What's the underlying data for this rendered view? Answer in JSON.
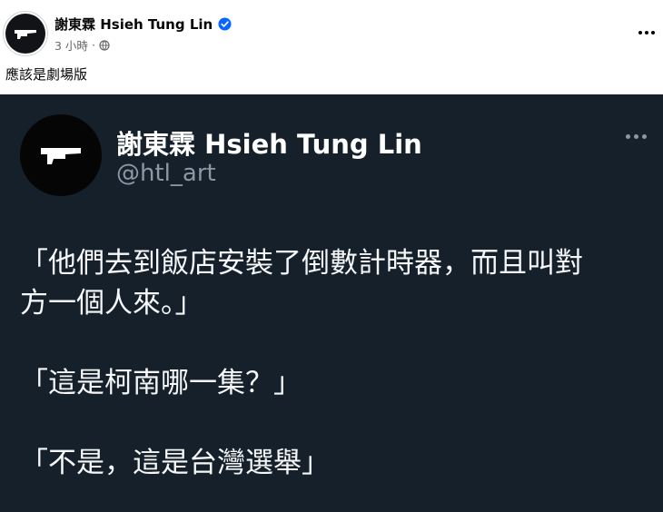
{
  "post": {
    "author_name": "謝東霖 Hsieh Tung Lin",
    "timestamp": "3 小時",
    "separator": "·",
    "caption": "應該是劇場版",
    "icons": {
      "verified": "verified-badge-icon",
      "audience": "globe-icon",
      "more": "more-options-icon"
    }
  },
  "tweet": {
    "display_name": "謝東霖 Hsieh Tung Lin",
    "handle": "@htl_art",
    "lines": [
      "「他們去到飯店安裝了倒數計時器，而且叫對",
      "方一個人來。」",
      "「這是柯南哪一集？」",
      "「不是，這是台灣選舉」"
    ]
  },
  "colors": {
    "verified_blue": "#0866ff",
    "tweet_background": "#15202b",
    "tweet_text": "#f5f7f9",
    "tweet_handle": "#8b98a5"
  }
}
